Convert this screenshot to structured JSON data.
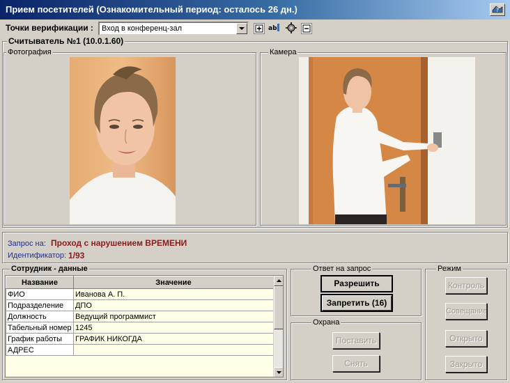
{
  "window": {
    "title": "Прием посетителей (Ознакомительный период: осталось 26 дн.)"
  },
  "toolbar": {
    "checkpoints_label": "Точки верификации :",
    "checkpoint_value": "Вход в конференц-зал"
  },
  "reader": {
    "title": "Считыватель №1 (10.0.1.60)",
    "photo_label": "Фотография",
    "camera_label": "Камера"
  },
  "request": {
    "label": "Запрос на:",
    "value": "Проход с нарушением ВРЕМЕНИ",
    "id_label": "Идентификатор:",
    "id_value": "1/93"
  },
  "employee": {
    "title": "Сотрудник - данные",
    "col_name": "Название",
    "col_value": "Значение",
    "rows": [
      {
        "name": "ФИО",
        "value": "Иванова А. П."
      },
      {
        "name": "Подразделение",
        "value": "ДПО"
      },
      {
        "name": "Должность",
        "value": "Ведущий программист"
      },
      {
        "name": "Табельный номер",
        "value": "1245"
      },
      {
        "name": "График работы",
        "value": "ГРАФИК НИКОГДА"
      },
      {
        "name": "АДРЕС",
        "value": ""
      }
    ]
  },
  "response": {
    "title": "Ответ на запрос",
    "allow": "Разрешить",
    "deny": "Запретить (16)"
  },
  "guard": {
    "title": "Охрана",
    "arm": "Поставить",
    "disarm": "Снять"
  },
  "mode": {
    "title": "Режим",
    "control": "Контроль",
    "meeting": "Совещание",
    "open": "Открыто",
    "closed": "Закрыто"
  },
  "colors": {
    "alert_text": "#8b1a1a",
    "label_text": "#1e2d8a",
    "title_bar": "#0a246a"
  }
}
